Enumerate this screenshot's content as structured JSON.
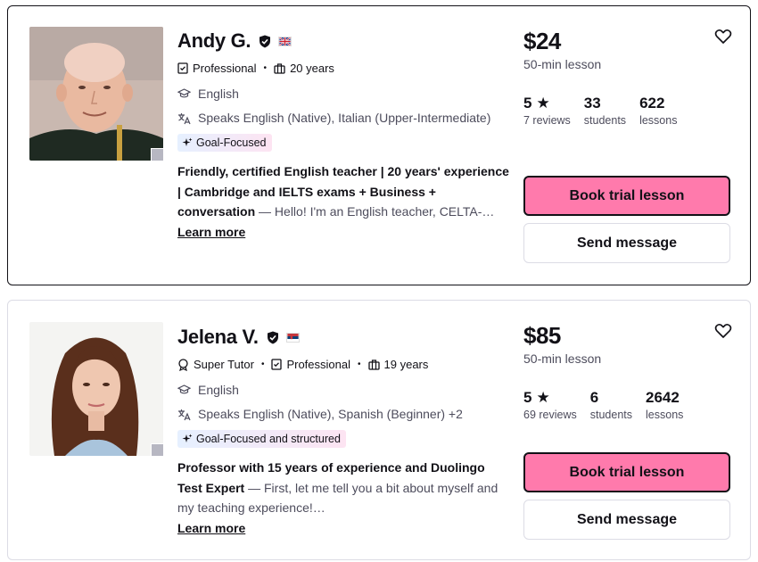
{
  "tutors": [
    {
      "name": "Andy G.",
      "meta": [
        "Professional",
        "20 years"
      ],
      "subject": "English",
      "speaks": "Speaks English (Native), Italian (Upper-Intermediate)",
      "tag": "Goal-Focused",
      "headline": "Friendly, certified English teacher | 20 years' experience | Cambridge and IELTS exams + Business + conversation",
      "intro": " — Hello! I'm an English teacher, CELTA-…",
      "learn_more": "Learn more",
      "price": "$24",
      "per": "50-min lesson",
      "rating": "5",
      "reviews": "7 reviews",
      "students": "33",
      "students_label": "students",
      "lessons": "622",
      "lessons_label": "lessons",
      "book_label": "Book trial lesson",
      "message_label": "Send message",
      "flag": "uk"
    },
    {
      "name": "Jelena V.",
      "meta": [
        "Super Tutor",
        "Professional",
        "19 years"
      ],
      "subject": "English",
      "speaks": "Speaks English (Native), Spanish (Beginner) +2",
      "tag": "Goal-Focused and structured",
      "headline": "Professor with 15 years of experience and Duolingo Test Expert",
      "intro": " — First, let me tell you a bit about myself and my teaching experience!…",
      "learn_more": "Learn more",
      "price": "$85",
      "per": "50-min lesson",
      "rating": "5",
      "reviews": "69 reviews",
      "students": "6",
      "students_label": "students",
      "lessons": "2642",
      "lessons_label": "lessons",
      "book_label": "Book trial lesson",
      "message_label": "Send message",
      "flag": "serbia"
    }
  ],
  "colors": {
    "book_bg": "#ff7aac",
    "text": "#121117",
    "muted": "#4d4c5c",
    "border": "#dcdce5"
  },
  "icons": {
    "verified": "shield-check-icon",
    "favorite": "heart-icon",
    "subject": "graduation-cap-icon",
    "speaks": "translate-icon",
    "tag": "sparkle-icon",
    "rating": "star-icon"
  }
}
